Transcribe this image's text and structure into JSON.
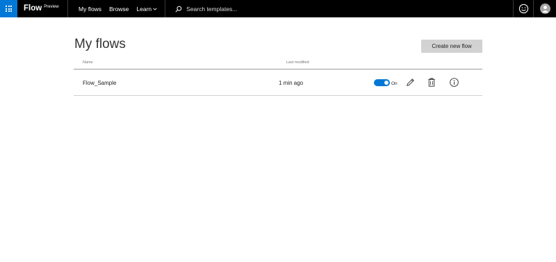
{
  "brand": {
    "name": "Flow",
    "tag": "Preview"
  },
  "nav": {
    "my_flows": "My flows",
    "browse": "Browse",
    "learn": "Learn"
  },
  "search": {
    "placeholder": "Search templates..."
  },
  "page": {
    "title": "My flows",
    "create_button": "Create new flow"
  },
  "table": {
    "headers": {
      "name": "Name",
      "last_modified": "Last modified"
    },
    "rows": [
      {
        "name": "Flow_Sample",
        "last_modified": "1 min ago",
        "status": "On"
      }
    ]
  },
  "colors": {
    "topbar": "#000000",
    "accent": "#0078d7",
    "button_bg": "#d2d2d2"
  },
  "icons": [
    "app-launcher-icon",
    "search-icon",
    "chevron-down-icon",
    "smiley-icon",
    "avatar-icon",
    "edit-icon",
    "delete-icon",
    "info-icon"
  ]
}
